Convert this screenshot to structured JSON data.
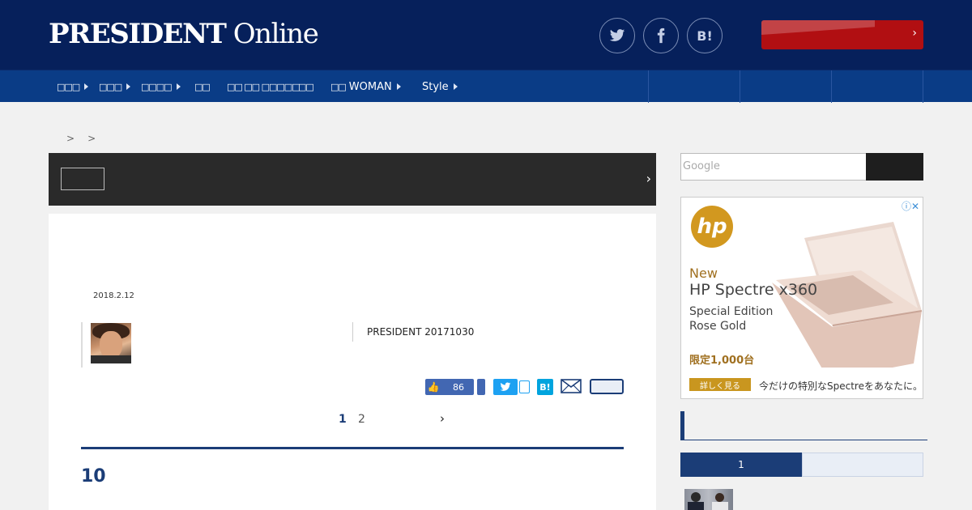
{
  "header": {
    "logo_bold": "PRESIDENT",
    "logo_light": " Online",
    "social": [
      {
        "name": "twitter-icon"
      },
      {
        "name": "facebook-icon"
      },
      {
        "name": "hatena-bookmark-icon",
        "label": "B!"
      }
    ],
    "cta_chevron": "›"
  },
  "nav": {
    "items": [
      {
        "label": "□□□"
      },
      {
        "label": "□□□"
      },
      {
        "label": "□□□□"
      },
      {
        "label": "□□"
      },
      {
        "label": "□□ □□ □□□□□"
      },
      {
        "label": "□□"
      },
      {
        "label": "WOMAN"
      },
      {
        "label": "Style"
      }
    ]
  },
  "breadcrumb": {
    "items": [
      ">",
      ">"
    ]
  },
  "banner": {
    "chevron": "›"
  },
  "article": {
    "date": "2018.2.12",
    "source": "PRESIDENT 20171030",
    "share": {
      "like_count": "86",
      "hatena": "B!"
    },
    "pagination": {
      "pages": [
        "1",
        "2"
      ],
      "current": "1",
      "next": "›"
    },
    "section_number": "10"
  },
  "sidebar": {
    "search_placeholder": "Google",
    "ad": {
      "brand": "hp",
      "line1": "New",
      "line2": "HP Spectre x360",
      "line3": "Special Edition",
      "line4": "Rose Gold",
      "line5": "限定1,000台",
      "cta": "詳しく見る",
      "tagline": "今だけの特別なSpectreをあなたに。",
      "icons": "ⓘ✕"
    },
    "ranking": {
      "tab_active": "1"
    }
  },
  "colors": {
    "header_bg": "#06205b",
    "nav_bg": "#0a3c86",
    "accent": "#1b3d77",
    "cta_red": "#b10f12"
  }
}
